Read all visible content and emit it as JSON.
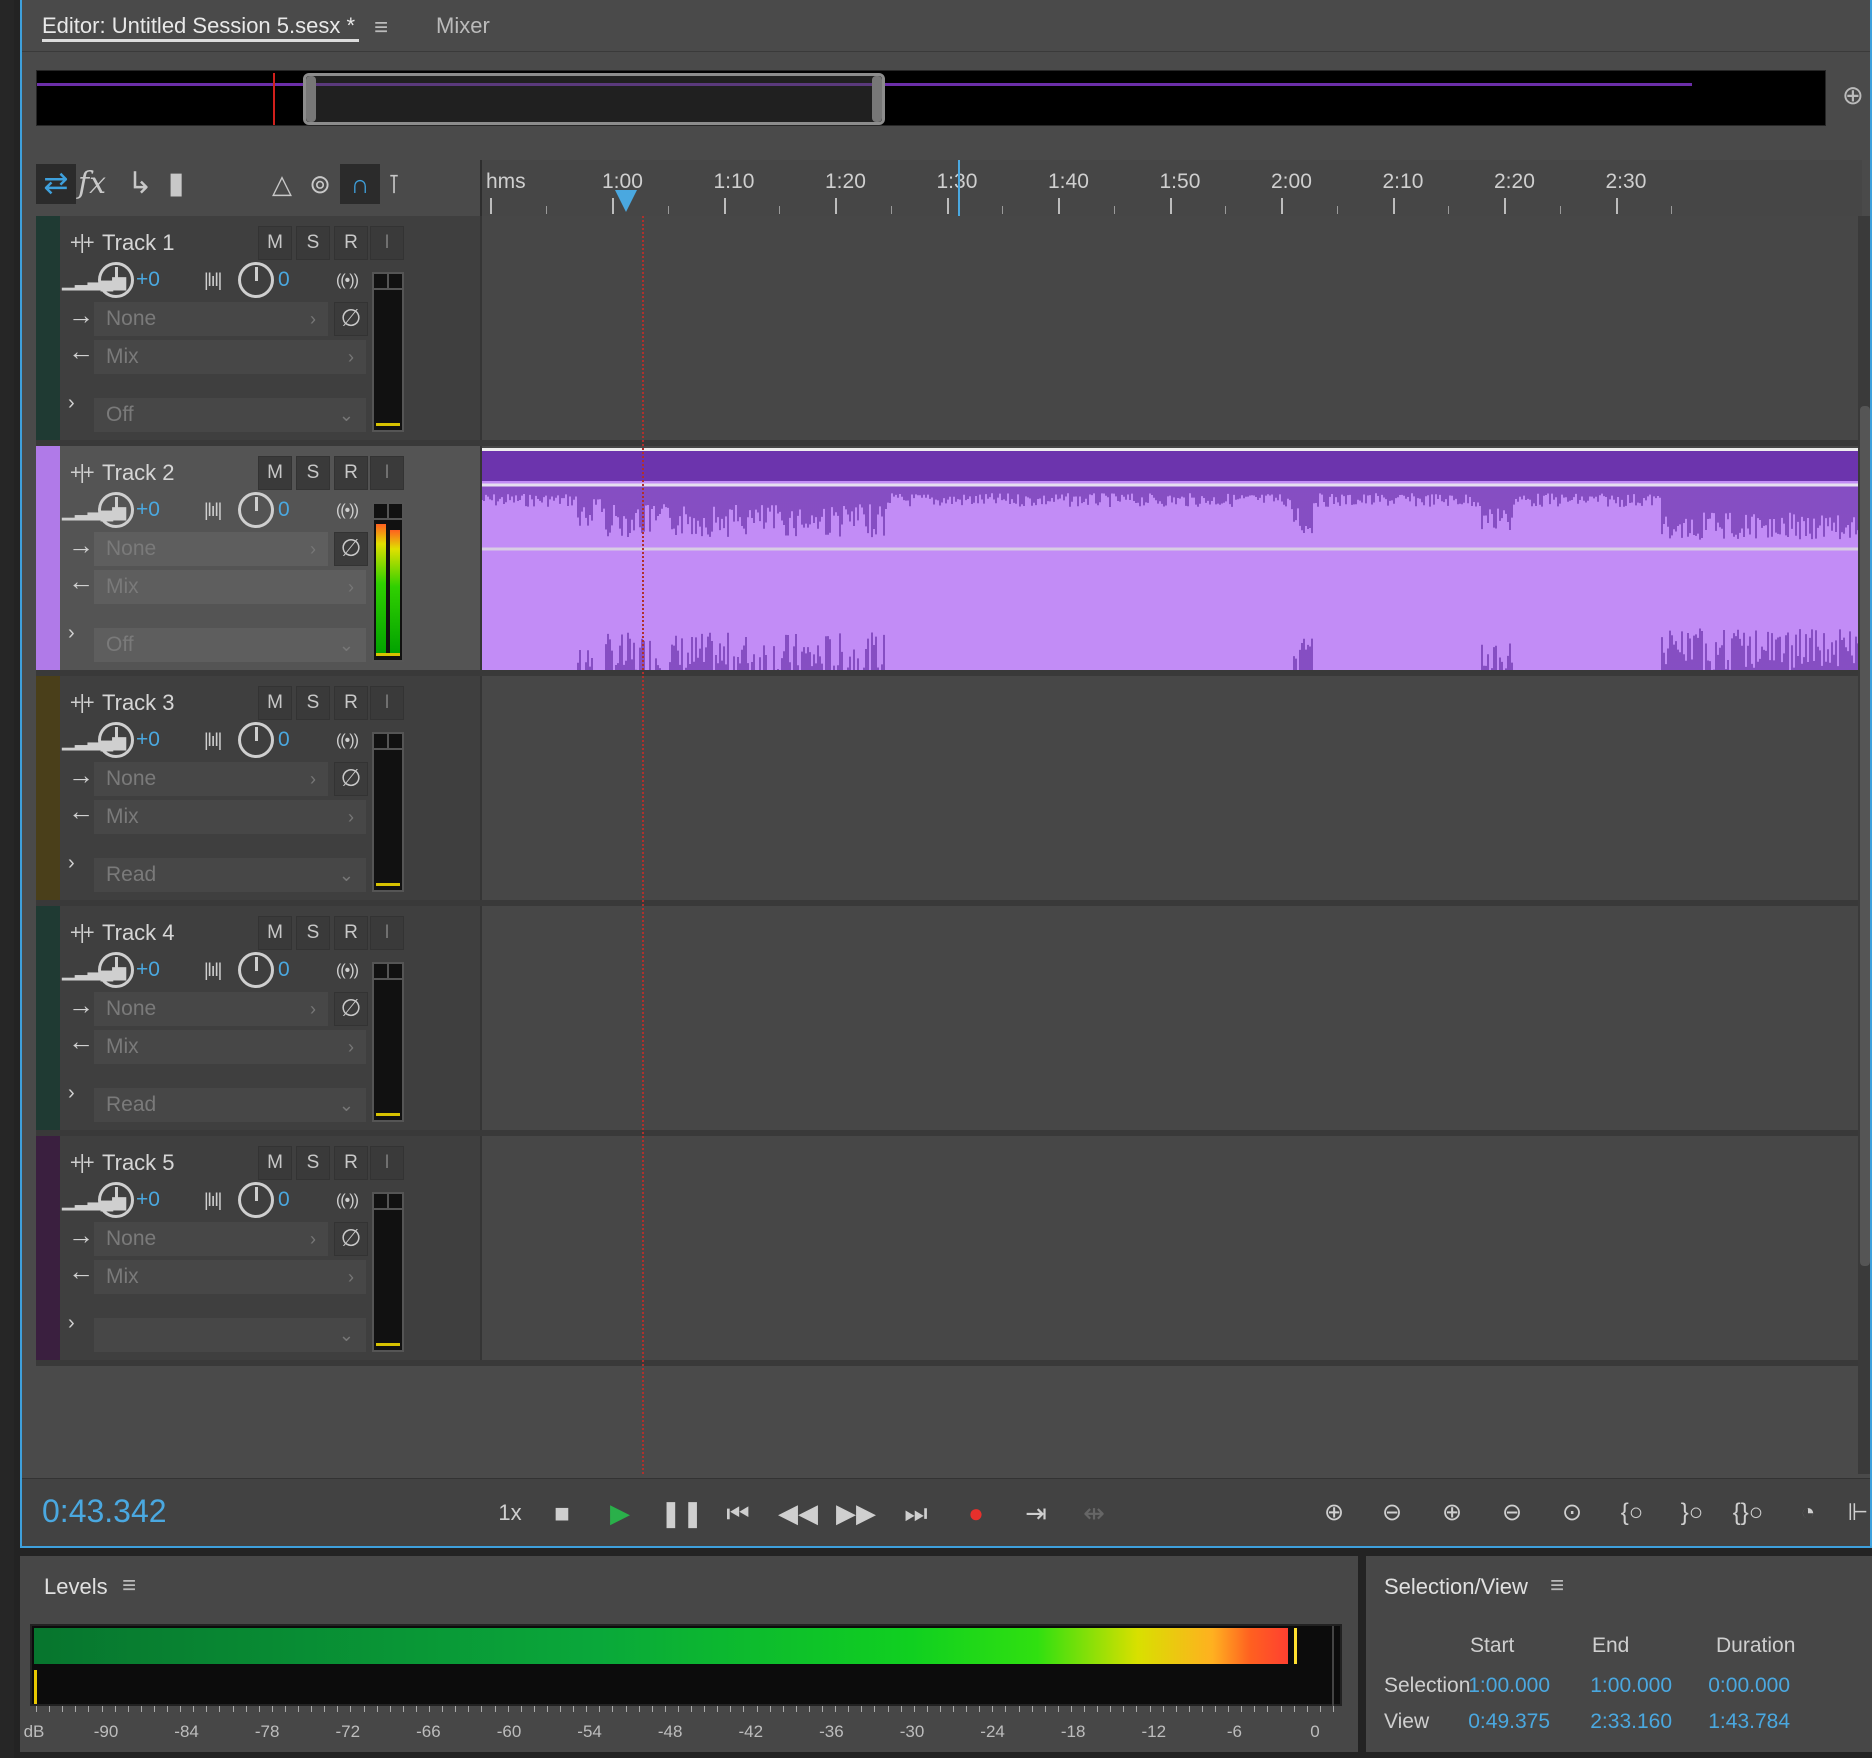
{
  "tabs": {
    "editor_label": "Editor: Untitled Session 5.sesx *",
    "menu_glyph": "≡",
    "mixer_label": "Mixer"
  },
  "ruler": {
    "unit_label": "hms",
    "ticks": [
      "1:00",
      "1:10",
      "1:20",
      "1:30",
      "1:40",
      "1:50",
      "2:00",
      "2:10",
      "2:20",
      "2:30"
    ]
  },
  "tracks": [
    {
      "name": "Track 1",
      "color": "#1f3a33",
      "volume": "+0",
      "pan": "0",
      "input": "None",
      "output": "Mix",
      "automation": "Off",
      "selected": false,
      "has_clip": false
    },
    {
      "name": "Track 2",
      "color": "#b07ae8",
      "volume": "+0",
      "pan": "0",
      "input": "None",
      "output": "Mix",
      "automation": "Off",
      "selected": true,
      "has_clip": true
    },
    {
      "name": "Track 3",
      "color": "#4a3f1a",
      "volume": "+0",
      "pan": "0",
      "input": "None",
      "output": "Mix",
      "automation": "Read",
      "selected": false,
      "has_clip": false
    },
    {
      "name": "Track 4",
      "color": "#1f3a33",
      "volume": "+0",
      "pan": "0",
      "input": "None",
      "output": "Mix",
      "automation": "Read",
      "selected": false,
      "has_clip": false
    },
    {
      "name": "Track 5",
      "color": "#3a1f3f",
      "volume": "+0",
      "pan": "0",
      "input": "None",
      "output": "Mix",
      "automation": "",
      "selected": false,
      "has_clip": false
    }
  ],
  "track_buttons": {
    "mute": "M",
    "solo": "S",
    "record": "R",
    "input_monitor": "I"
  },
  "transport": {
    "timecode": "0:43.342",
    "speed": "1x"
  },
  "levels": {
    "title": "Levels",
    "menu_glyph": "≡",
    "scale_labels": [
      "dB",
      "-90",
      "-84",
      "-78",
      "-72",
      "-66",
      "-60",
      "-54",
      "-48",
      "-42",
      "-36",
      "-30",
      "-24",
      "-18",
      "-12",
      "-6",
      "0"
    ]
  },
  "selection_view": {
    "title": "Selection/View",
    "menu_glyph": "≡",
    "headers": {
      "start": "Start",
      "end": "End",
      "duration": "Duration"
    },
    "rows": [
      {
        "label": "Selection",
        "start": "1:00.000",
        "end": "1:00.000",
        "duration": "0:00.000"
      },
      {
        "label": "View",
        "start": "0:49.375",
        "end": "2:33.160",
        "duration": "1:43.784"
      }
    ]
  },
  "colors": {
    "accent": "#3ea0dc",
    "clip_fill": "#c28cf6",
    "clip_wave": "#6c34ad",
    "playhead": "#b0302c",
    "record": "#e8302c",
    "play": "#2ab04a"
  }
}
